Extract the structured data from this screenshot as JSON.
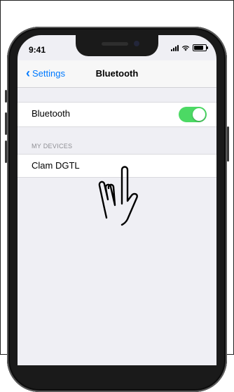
{
  "status_bar": {
    "time": "9:41"
  },
  "nav": {
    "back_label": "Settings",
    "title": "Bluetooth"
  },
  "bluetooth_row": {
    "label": "Bluetooth",
    "toggle_on": true,
    "toggle_color": "#4cd964"
  },
  "section": {
    "header": "MY DEVICES"
  },
  "devices": [
    {
      "name": "Clam DGTL"
    }
  ],
  "accent_color": "#007aff",
  "icons": [
    "signal-icon",
    "wifi-icon",
    "battery-icon",
    "back-chevron-icon",
    "hand-pointer-icon"
  ]
}
